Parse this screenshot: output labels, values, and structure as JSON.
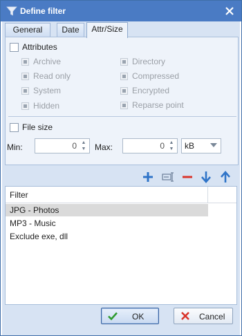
{
  "window": {
    "title": "Define filter"
  },
  "tabs": [
    {
      "label": "General",
      "active": false
    },
    {
      "label": "Date",
      "active": false
    },
    {
      "label": "Attr/Size",
      "active": true
    }
  ],
  "attributes": {
    "label": "Attributes",
    "checked": false,
    "left": [
      {
        "label": "Archive"
      },
      {
        "label": "Read only"
      },
      {
        "label": "System"
      },
      {
        "label": "Hidden"
      }
    ],
    "right": [
      {
        "label": "Directory"
      },
      {
        "label": "Compressed"
      },
      {
        "label": "Encrypted"
      },
      {
        "label": "Reparse point"
      }
    ]
  },
  "file_size": {
    "label": "File size",
    "checked": false,
    "min_label": "Min:",
    "min_value": "0",
    "max_label": "Max:",
    "max_value": "0",
    "unit": "kB"
  },
  "toolbar": {
    "icons": [
      "add-icon",
      "edit-icon",
      "remove-icon",
      "move-down-icon",
      "move-up-icon"
    ]
  },
  "filter_list": {
    "header": "Filter",
    "rows": [
      "JPG - Photos",
      "MP3 - Music",
      "Exclude exe, dll"
    ],
    "selected": "JPG - Photos"
  },
  "buttons": {
    "ok": "OK",
    "cancel": "Cancel"
  },
  "colors": {
    "titlebar": "#4a7bc4",
    "accent": "#2f74c8",
    "danger": "#d9342b",
    "ok_check": "#2e9b2e"
  }
}
